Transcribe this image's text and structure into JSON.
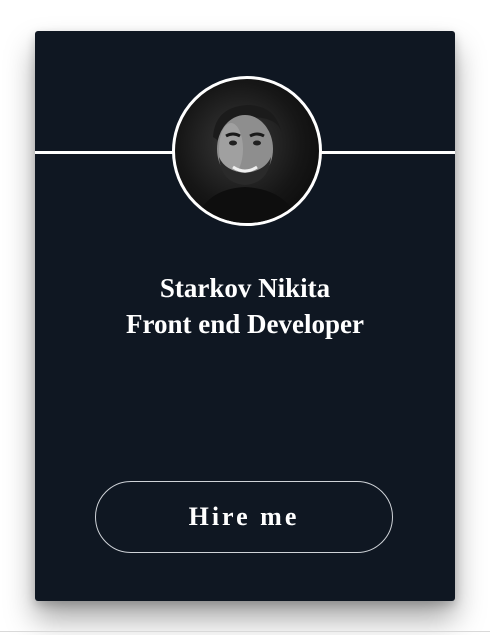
{
  "card": {
    "name": "Starkov Nikita",
    "role": "Front end Developer",
    "hire_button_label": "Hire me"
  },
  "colors": {
    "card_background": "#0f1722",
    "text": "#ffffff",
    "page_background": "#ffffff"
  },
  "icons": {
    "avatar": "profile-photo"
  }
}
